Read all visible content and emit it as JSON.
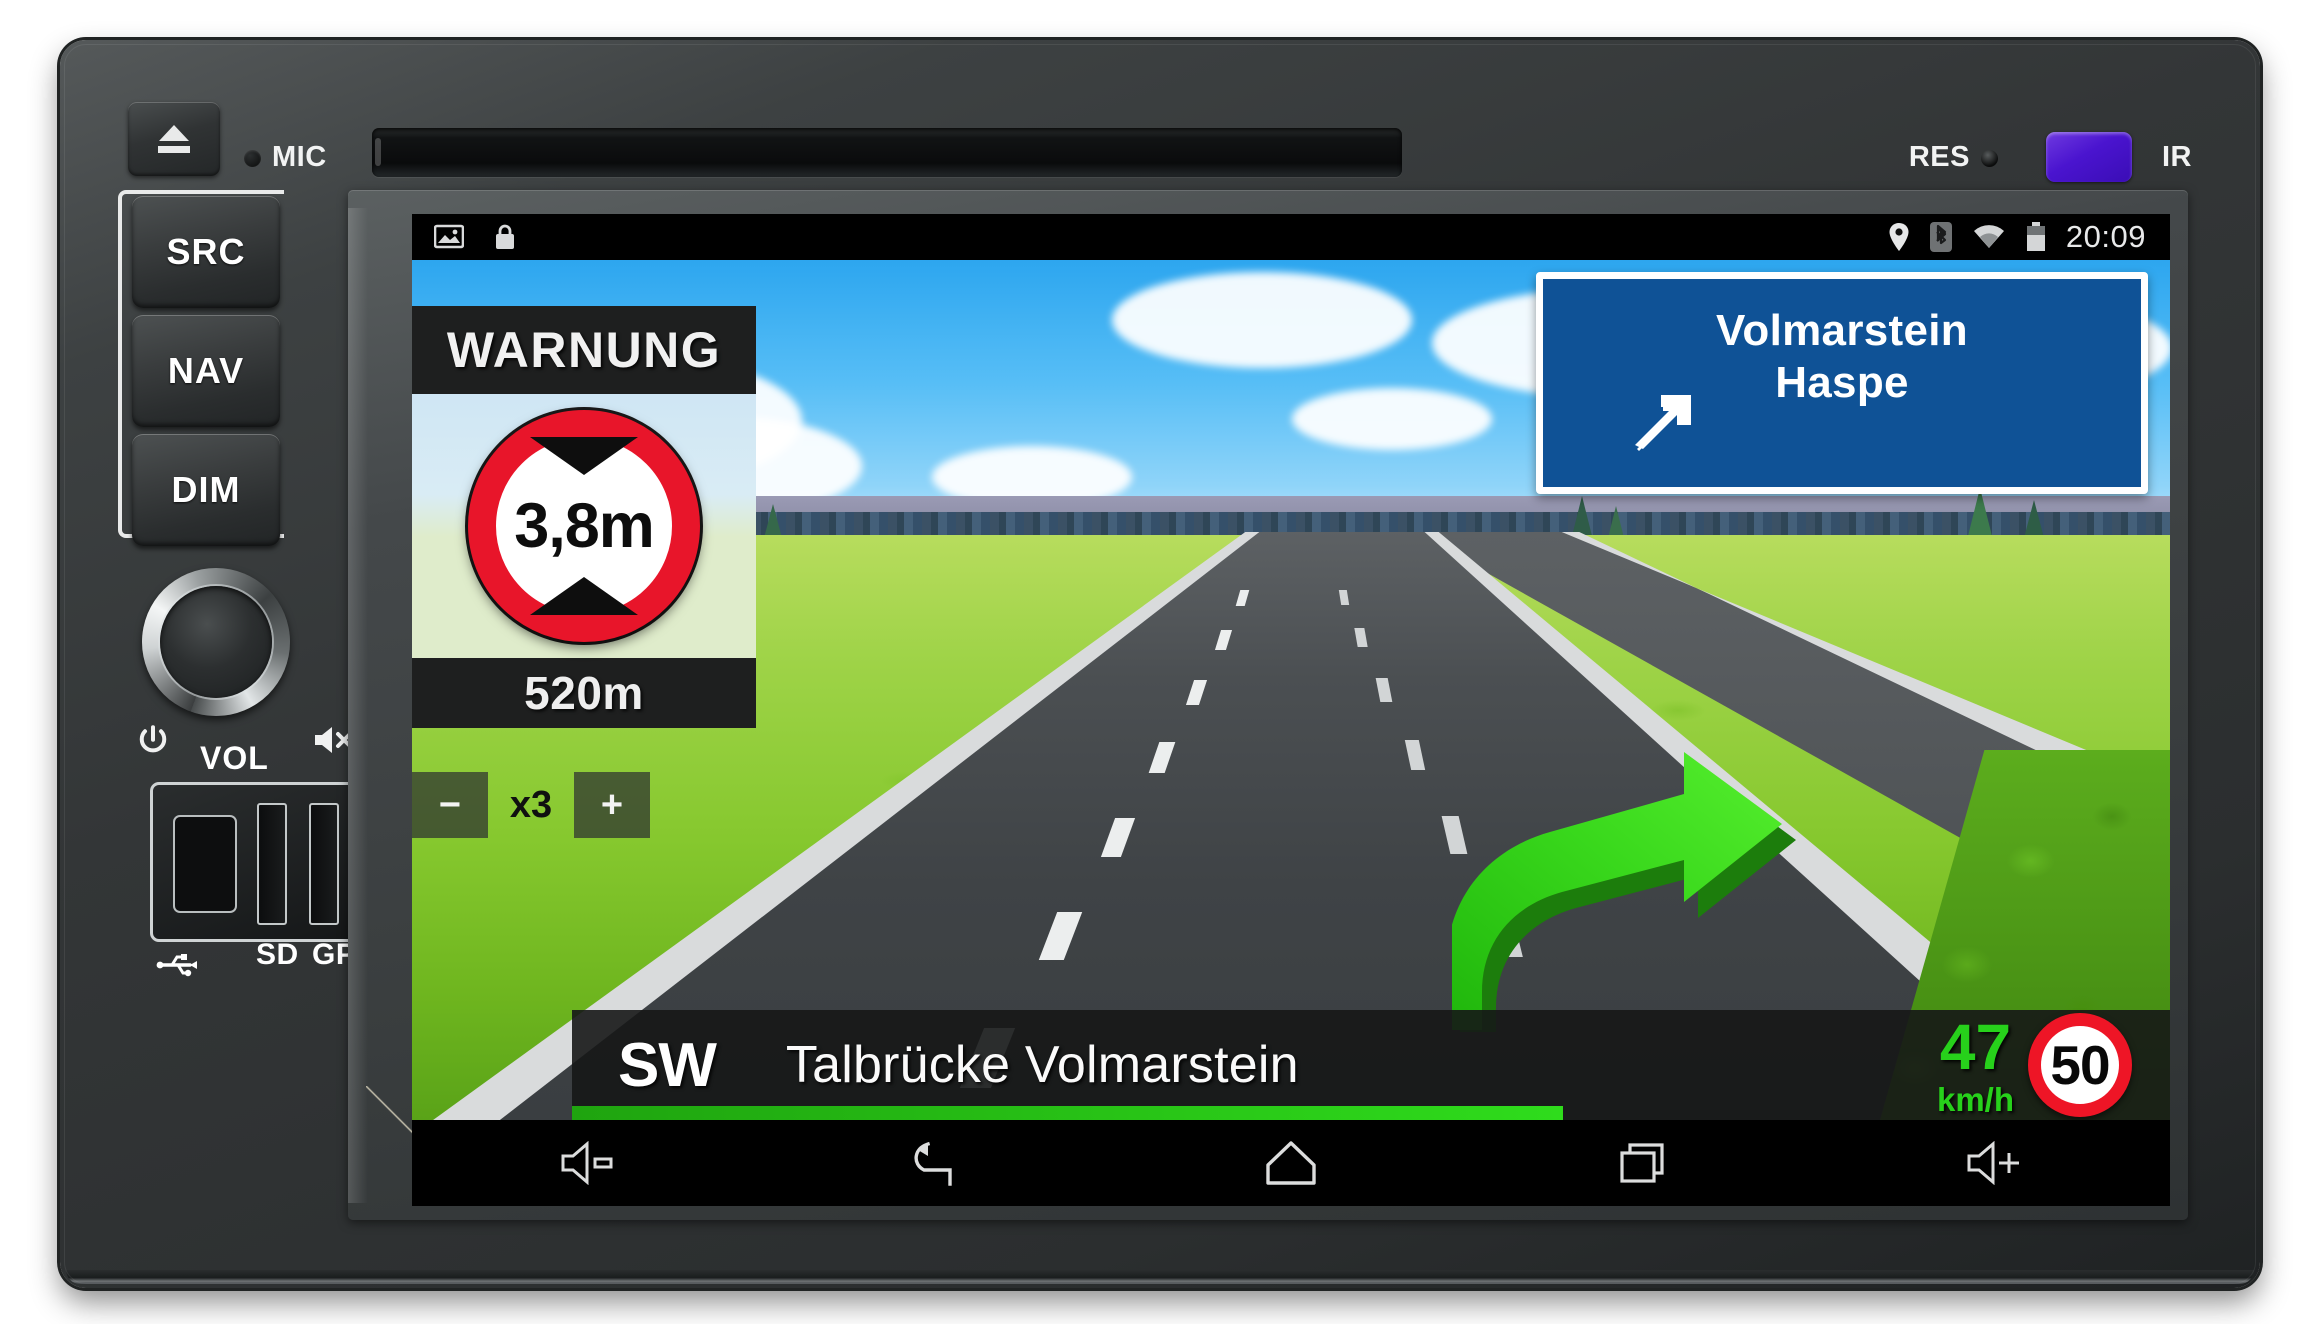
{
  "device": {
    "top": {
      "eject_icon": "eject-icon",
      "mic_label": "MIC",
      "cd_slot_name": "cd-slot",
      "res_label": "RES",
      "res_hole_name": "reset-hole",
      "ir_window_name": "ir-window",
      "ir_label": "IR"
    },
    "side_buttons": [
      {
        "label": "SRC",
        "name": "src-button"
      },
      {
        "label": "NAV",
        "name": "nav-button"
      },
      {
        "label": "DIM",
        "name": "dim-button"
      }
    ],
    "knob": {
      "name": "volume-knob",
      "vol_label": "VOL",
      "power_icon": "power-icon",
      "mute_icon": "mute-icon"
    },
    "slots": {
      "usb_icon": "usb-icon",
      "sd_label": "SD",
      "gps_label": "GPS"
    }
  },
  "screen": {
    "statusbar": {
      "left_icons": [
        "screenshot-icon",
        "lock-icon"
      ],
      "right_icons": [
        "location-pin-icon",
        "bluetooth-icon",
        "wifi-icon",
        "battery-icon"
      ],
      "time": "20:09"
    },
    "warning": {
      "title": "WARNUNG",
      "sign_value": "3,8m",
      "sign_type": "height-restriction",
      "distance": "520m"
    },
    "zoom_control": {
      "minus": "−",
      "level": "x3",
      "plus": "+"
    },
    "destination_sign": {
      "line1": "Volmarstein",
      "line2": "Haspe",
      "arrow": "diagonal-up-right",
      "background_color": "#0f5296"
    },
    "route": {
      "arrow_direction": "right-turn",
      "arrow_color": "#3ddc1b"
    },
    "infobar": {
      "direction": "SW",
      "street": "Talbrücke Volmarstein",
      "speed_value": "47",
      "speed_unit": "km/h",
      "speed_color": "#27d11b",
      "speed_limit": "50"
    },
    "navbar": [
      {
        "name": "volume-down-icon",
        "label": "volume down"
      },
      {
        "name": "back-icon",
        "label": "back"
      },
      {
        "name": "home-icon",
        "label": "home"
      },
      {
        "name": "recents-icon",
        "label": "recent apps"
      },
      {
        "name": "volume-up-icon",
        "label": "volume up"
      }
    ]
  }
}
